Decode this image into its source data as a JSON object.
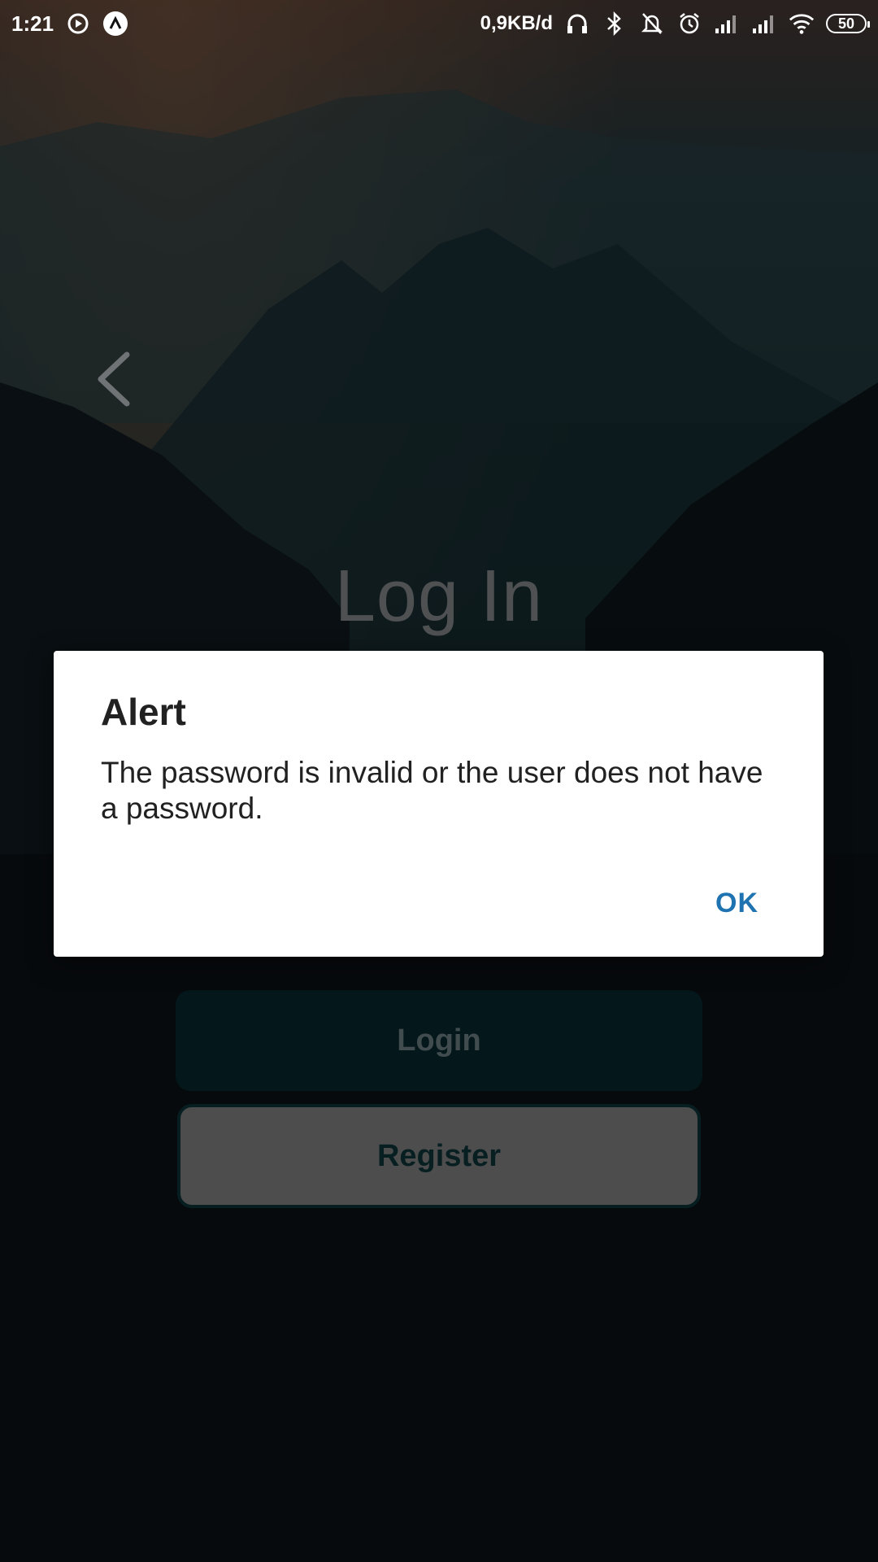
{
  "status_bar": {
    "time": "1:21",
    "network_speed": "0,9KB/d",
    "battery": "50",
    "icons": [
      "sync-icon",
      "app-a-icon",
      "headphones-icon",
      "bluetooth-icon",
      "notifications-off-icon",
      "alarm-icon",
      "signal-icon",
      "signal-icon",
      "wifi-icon",
      "battery-icon"
    ]
  },
  "screen": {
    "title": "Log In",
    "login_button": "Login",
    "register_button": "Register",
    "back_icon": "chevron-left-icon"
  },
  "dialog": {
    "title": "Alert",
    "message": "The password is invalid or the user does not have a password.",
    "ok_label": "OK"
  },
  "colors": {
    "dialog_accent": "#1f73b0",
    "login_button_bg": "#062025",
    "register_button_bg": "#6b6b6b"
  }
}
